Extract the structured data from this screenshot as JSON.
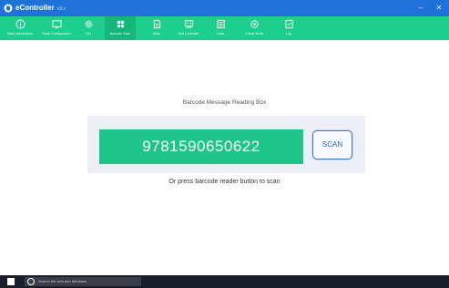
{
  "window": {
    "title": "eController",
    "version": "v3.x",
    "minimize_symbol": "–",
    "close_symbol": "✕"
  },
  "toolbar": {
    "items": [
      {
        "label": "Basic Information",
        "icon": "info-icon"
      },
      {
        "label": "Basic Configuration",
        "icon": "monitor-icon"
      },
      {
        "label": "Set",
        "icon": "gear-icon"
      },
      {
        "label": "Barcode Scan",
        "icon": "barcode-grid-icon",
        "active": true
      },
      {
        "label": "Work",
        "icon": "document-icon"
      },
      {
        "label": "Test Controller",
        "icon": "controller-icon"
      },
      {
        "label": "Data",
        "icon": "data-icon"
      },
      {
        "label": "Check Tools",
        "icon": "tools-icon"
      },
      {
        "label": "Log",
        "icon": "log-icon"
      }
    ]
  },
  "main": {
    "box_title": "Barcode Message Reading Box",
    "barcode_value": "9781590650622",
    "scan_label": "SCAN",
    "hint": "Or press barcode reader button to scan"
  },
  "taskbar": {
    "search_placeholder": "Search the web and Windows"
  },
  "colors": {
    "titlebar": "#1f73d8",
    "toolbar": "#1ccf8c",
    "barcode_field": "#1fc48a",
    "scan_border": "#3d76c7",
    "taskbar": "#1b1f2b"
  }
}
